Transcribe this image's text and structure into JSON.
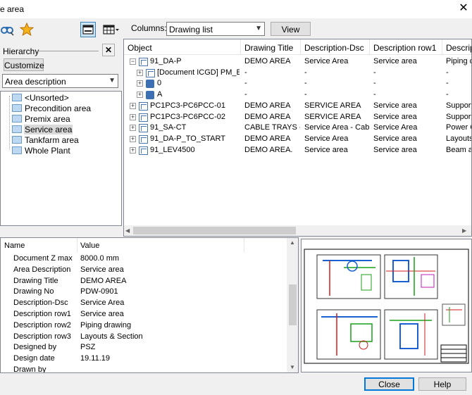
{
  "window": {
    "title": "e area",
    "close_glyph": "✕"
  },
  "toolbar": {
    "columns_label": "Columns:",
    "columns_value": "Drawing list",
    "view_button": "View",
    "icons": [
      "binoculars-icon",
      "star-icon",
      "single-pane-icon",
      "grid-view-icon"
    ]
  },
  "hierarchy": {
    "label": "Hierarchy",
    "close_glyph": "✕",
    "customize_button": "Customize",
    "mode_value": "Area description",
    "items": [
      {
        "label": "<Unsorted>",
        "selected": false
      },
      {
        "label": "Precondition area",
        "selected": false
      },
      {
        "label": "Premix area",
        "selected": false
      },
      {
        "label": "Service area",
        "selected": true
      },
      {
        "label": "Tankfarm area",
        "selected": false
      },
      {
        "label": "Whole Plant",
        "selected": false
      }
    ]
  },
  "grid": {
    "headers": [
      "Object",
      "Drawing Title",
      "Description-Dsc",
      "Description row1",
      "Descripti"
    ],
    "rows": [
      {
        "indent": 0,
        "expander": "−",
        "icon": "document-icon",
        "cells": [
          "91_DA-P",
          "DEMO AREA",
          "Service Area",
          "Service area",
          "Piping d"
        ]
      },
      {
        "indent": 1,
        "expander": "+",
        "icon": "document-icon",
        "cells": [
          "[Document ICGD] PM_Ex...",
          "-",
          "-",
          "-",
          "-"
        ]
      },
      {
        "indent": 1,
        "expander": "+",
        "icon": "cube-icon",
        "cells": [
          "0",
          "-",
          "-",
          "-",
          "-"
        ]
      },
      {
        "indent": 1,
        "expander": "+",
        "icon": "cube-icon",
        "cells": [
          "A",
          "-",
          "-",
          "-",
          "-"
        ]
      },
      {
        "indent": 0,
        "expander": "+",
        "icon": "document-icon",
        "cells": [
          "PC1PC3-PC6PCC-01",
          "DEMO AREA",
          "SERVICE AREA",
          "Service area",
          "Support"
        ]
      },
      {
        "indent": 0,
        "expander": "+",
        "icon": "document-icon",
        "cells": [
          "PC1PC3-PC6PCC-02",
          "DEMO AREA",
          "SERVICE AREA",
          "Service area",
          "Support"
        ]
      },
      {
        "indent": 0,
        "expander": "+",
        "icon": "document-icon",
        "cells": [
          "91_SA-CT",
          "CABLE TRAYS -...",
          "Service Area - Cab...",
          "Service Area",
          "Power C"
        ]
      },
      {
        "indent": 0,
        "expander": "+",
        "icon": "document-icon",
        "cells": [
          "91_DA-P_TO_START",
          "DEMO AREA",
          "Service Area",
          "Service area",
          "Layouts"
        ]
      },
      {
        "indent": 0,
        "expander": "+",
        "icon": "document-icon",
        "cells": [
          "91_LEV4500",
          "DEMO AREA.",
          "Service area",
          "Service area",
          "Beam ar"
        ]
      }
    ]
  },
  "properties": {
    "headers": [
      "Name",
      "Value"
    ],
    "rows": [
      [
        "Document Z max",
        "8000.0 mm"
      ],
      [
        "Area Description",
        "Service area"
      ],
      [
        "Drawing Title",
        "DEMO AREA"
      ],
      [
        "Drawing No",
        "PDW-0901"
      ],
      [
        "Description-Dsc",
        "Service Area"
      ],
      [
        "Description row1",
        "Service area"
      ],
      [
        "Description row2",
        "Piping drawing"
      ],
      [
        "Description row3",
        "Layouts & Section"
      ],
      [
        "Designed by",
        "PSZ"
      ],
      [
        "Design date",
        "19.11.19"
      ],
      [
        "Drawn by",
        ""
      ]
    ]
  },
  "footer": {
    "close_button": "Close",
    "help_button": "Help"
  },
  "colors": {
    "accent": "#0078d7",
    "selection": "#cce4f7",
    "folder": "#bcd9f1"
  }
}
